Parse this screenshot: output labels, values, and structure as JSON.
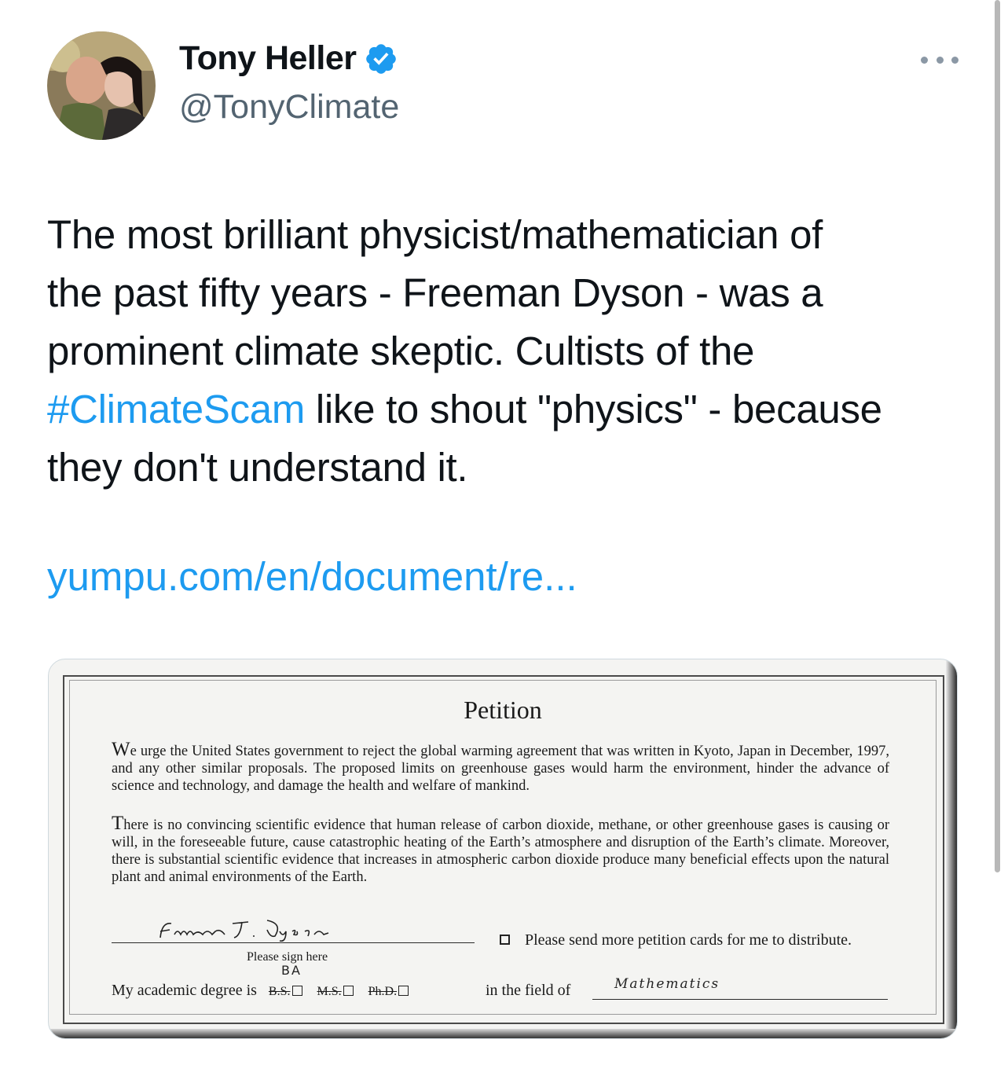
{
  "author": {
    "name": "Tony Heller",
    "handle": "@TonyClimate"
  },
  "tweet": {
    "text_line1": "The most brilliant physicist/mathematician of",
    "text_line2": "the past fifty years - Freeman Dyson - was a",
    "text_line3": "prominent climate skeptic. Cultists of the",
    "hashtag": "#ClimateScam",
    "text_line4_rest": " like to shout \"physics\" - because",
    "text_line5": "they don't understand it.",
    "link": "yumpu.com/en/document/re..."
  },
  "document": {
    "title": "Petition",
    "p1_lead": "W",
    "p1": "e urge the United States government to reject the global warming agreement that was written in Kyoto, Japan in December, 1997, and any other similar proposals. The proposed limits on greenhouse gases would harm the environment, hinder the advance of science and technology, and damage the health and welfare of mankind.",
    "p2_lead": "T",
    "p2": "here is no convincing scientific evidence that human release of carbon dioxide, methane, or other greenhouse gases is causing or will, in the foreseeable future, cause catastrophic heating of the Earth’s atmosphere and disruption of the Earth’s climate. Moreover, there is substantial scientific evidence that increases in atmospheric carbon dioxide produce many beneficial effects upon the natural plant and animal environments of the Earth.",
    "signature": "Freeman J. Dyson",
    "sign_label": "Please sign here",
    "send_cards": "Please send more petition cards for me to distribute.",
    "degree_handwritten": "BA",
    "degree_label": "My academic degree is",
    "degree_options": [
      "B.S.",
      "M.S.",
      "Ph.D."
    ],
    "field_label": "in the field of",
    "field_value": "Mathematics"
  },
  "colors": {
    "link": "#1d9bf0",
    "verified": "#1d9bf0",
    "secondary_text": "#536471"
  },
  "icons": [
    "verified-badge-icon",
    "more-options-icon"
  ]
}
